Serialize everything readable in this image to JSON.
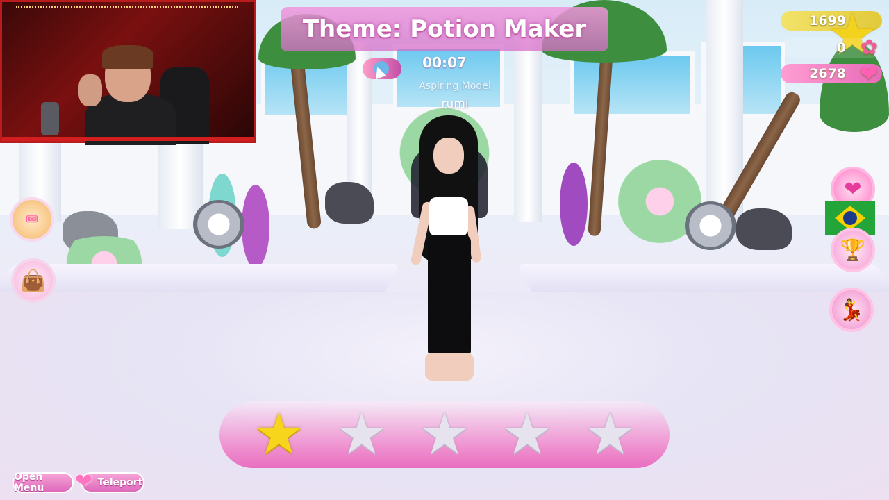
{
  "header": {
    "theme_title": "Theme: Potion Maker",
    "timer": "00:07",
    "rank": "Aspiring Model",
    "player_name": "rumi"
  },
  "currency": {
    "stars": "1699",
    "flowers": "0",
    "hearts": "2678"
  },
  "side_buttons": {
    "left": [
      {
        "name": "beach-pass-icon",
        "label": "Beach Pass"
      },
      {
        "name": "shop-icon",
        "label": ""
      }
    ],
    "right": [
      {
        "name": "hearts-icon"
      },
      {
        "name": "language-flag-brazil"
      },
      {
        "name": "trophy-icon"
      },
      {
        "name": "pose-icon"
      }
    ]
  },
  "rating": {
    "max_stars": 5,
    "selected": 1
  },
  "bottom_buttons": {
    "open_menu": "Open Menu",
    "teleport": "Teleport"
  },
  "colors": {
    "accent_pink": "#e86fc0",
    "star_gold": "#f7d51d",
    "star_empty": "#e7e3ee"
  }
}
